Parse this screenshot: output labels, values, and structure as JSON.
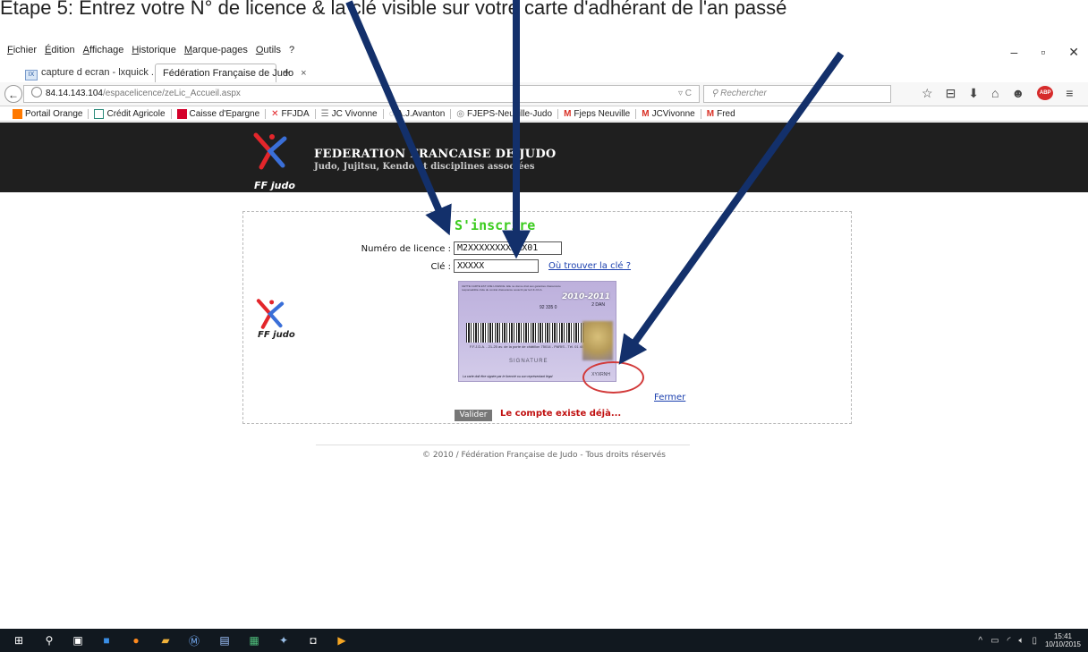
{
  "caption": "Étape 5: Entrez votre N° de licence & la clé visible sur votre carte d'adhérant de l'an passé",
  "browser": {
    "menu": [
      "Fichier",
      "Édition",
      "Affichage",
      "Historique",
      "Marque-pages",
      "Outils",
      "?"
    ],
    "tabs": [
      {
        "label": "capture d ecran - lxquick ...",
        "favicon": "IX",
        "active": false
      },
      {
        "label": "Fédération Française de Judo",
        "active": true
      }
    ],
    "new_tab": "+",
    "url_host": "84.14.143.104",
    "url_path": "/espacelicence/zeLic_Accueil.aspx",
    "search_placeholder": "Rechercher",
    "bookmarks": [
      {
        "label": "Portail Orange",
        "icon": "orange-square-icon",
        "color": "#ff7900"
      },
      {
        "label": "Crédit Agricole",
        "icon": "credit-agricole-icon",
        "color": "#2a8a7a"
      },
      {
        "label": "Caisse d'Epargne",
        "icon": "caisse-epargne-icon",
        "color": "#d4002a"
      },
      {
        "label": "FFJDA",
        "icon": "ffjda-icon",
        "color": "#e3262b"
      },
      {
        "label": "JC Vivonne",
        "icon": "jc-vivonne-icon",
        "color": "#777777"
      },
      {
        "label": "A.J.Avanton",
        "icon": "avanton-icon",
        "color": "#777777"
      },
      {
        "label": "FJEPS-Neuville-Judo",
        "icon": "fjeps-icon",
        "color": "#777777"
      },
      {
        "label": "Fjeps Neuville",
        "icon": "gmail-icon",
        "color": "#d93025"
      },
      {
        "label": "JCVivonne",
        "icon": "gmail-icon",
        "color": "#d93025"
      },
      {
        "label": "Fred",
        "icon": "gmail-icon",
        "color": "#d93025"
      }
    ]
  },
  "site": {
    "logo_text": "FF judo",
    "title": "FEDERATION FRANCAISE DE JUDO",
    "subtitle": "Judo, Jujitsu, Kendo et disciplines associées"
  },
  "form": {
    "title": "S'inscrire",
    "licence_label": "Numéro de licence :",
    "licence_value": "M2XXXXXXXXXXX01",
    "cle_label": "Clé :",
    "cle_value": "XXXXX",
    "where_key_link": "Où trouver la clé ?",
    "card": {
      "season": "2010-2011",
      "grade": "2 DAN",
      "number": "92 335 0",
      "signature": "SIGNATURE",
      "address": "F.F.J.D.A. - 21-25 av. de la porte de châtillon 75014 - PARIS - Tél. 01 40 52 16 61 - 02",
      "footer": "La carte doit être signée par le licencié ou son représentant légal",
      "key_text": "XYXRNH"
    },
    "close_link": "Fermer",
    "submit": "Valider",
    "message": "Le compte existe déjà..."
  },
  "footer": "© 2010 / Fédération Française de Judo - Tous droits réservés",
  "taskbar": {
    "time": "15:41",
    "date": "10/10/2015"
  },
  "colors": {
    "arrow": "#13306b",
    "header_bg": "#1f1f1f",
    "title_green": "#3ccc1f",
    "error_red": "#c01010",
    "highlight_circle": "#d23a3a"
  }
}
